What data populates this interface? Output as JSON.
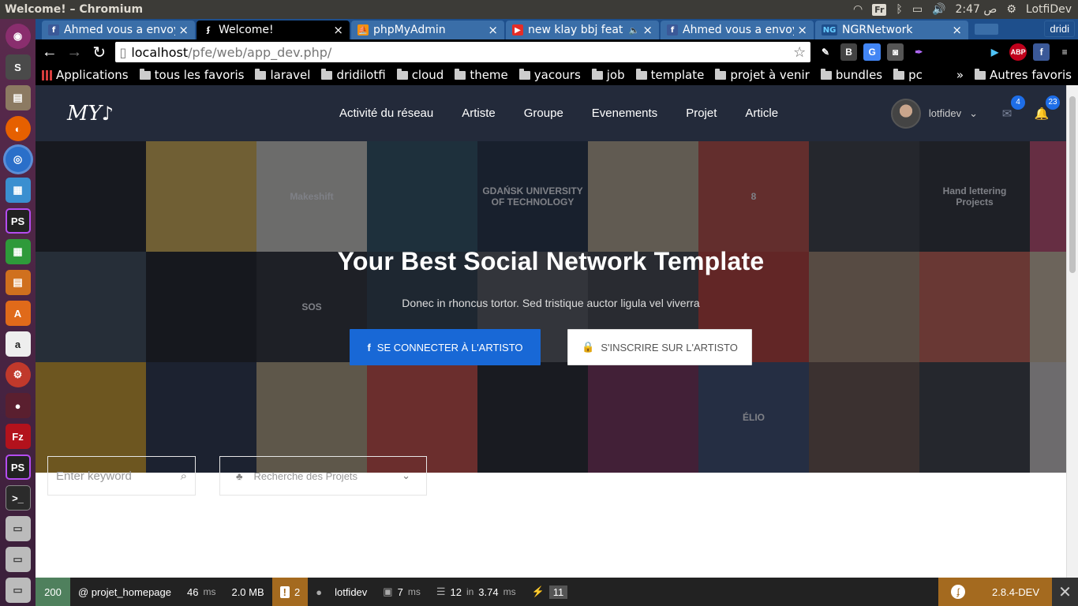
{
  "system": {
    "window_title": "Welcome! – Chromium",
    "keyboard_layout": "Fr",
    "clock": "2:47 ص",
    "user": "LotfiDev"
  },
  "launcher": {
    "items": [
      "ubuntu-icon",
      "sublime-icon",
      "files-icon",
      "firefox-icon",
      "chromium-icon",
      "writer-icon",
      "phpstorm-icon",
      "calc-icon",
      "impress-icon",
      "software-center-icon",
      "amazon-icon",
      "settings-icon",
      "ssh-icon",
      "filezilla-icon",
      "phpstorm-icon",
      "terminal-icon",
      "drive-icon",
      "drive-icon",
      "drive-icon"
    ]
  },
  "browser": {
    "profile": "dridi",
    "tabs": [
      {
        "label": "Ahmed vous a envoy",
        "icon": "facebook-icon",
        "active": false
      },
      {
        "label": "Welcome!",
        "icon": "symfony-icon",
        "active": true
      },
      {
        "label": "phpMyAdmin",
        "icon": "phpmyadmin-icon",
        "active": false
      },
      {
        "label": "new klay bbj feat",
        "icon": "youtube-icon",
        "active": false
      },
      {
        "label": "Ahmed vous a envoy",
        "icon": "facebook-icon",
        "active": false
      },
      {
        "label": "NGRNetwork",
        "icon": "ngr-icon",
        "active": false
      }
    ],
    "url_host": "localhost",
    "url_path": "/pfe/web/app_dev.php/",
    "bookmarks": [
      "Applications",
      "tous les favoris",
      "laravel",
      "dridilotfi",
      "cloud",
      "theme",
      "yacours",
      "job",
      "template",
      "projet à venir",
      "bundles",
      "pc"
    ],
    "bookmarks_more": "»",
    "other_bookmarks": "Autres favoris"
  },
  "site": {
    "logo": "MY",
    "menu": [
      "Activité du réseau",
      "Artiste",
      "Groupe",
      "Evenements",
      "Projet",
      "Article"
    ],
    "username": "lotfidev",
    "messages_count": "4",
    "notifications_count": "23",
    "hero_title": "Your Best Social Network Template",
    "hero_subtitle": "Donec in rhoncus tortor. Sed tristique auctor ligula vel viverra",
    "btn_facebook": "SE CONNECTER À L'ARTISTO",
    "btn_register": "S'INSCRIRE SUR L'ARTISTO",
    "tile_texts": [
      "",
      "",
      "Makeshift",
      "",
      "GDAŃSK UNIVERSITY OF TECHNOLOGY",
      "",
      "8",
      "",
      "Hand lettering Projects",
      "",
      "",
      "",
      "SOS",
      "",
      "",
      "",
      "",
      "",
      "",
      "",
      "",
      "",
      "",
      "",
      "",
      "",
      "ÉLIO",
      "",
      "",
      ""
    ],
    "search_placeholder": "Enter keyword",
    "project_select": "Recherche des Projets"
  },
  "debug_toolbar": {
    "status": "200",
    "route": "@ projet_homepage",
    "time": "46",
    "time_unit": "ms",
    "memory": "2.0 MB",
    "warnings": "2",
    "user": "lotfidev",
    "render_time": "7",
    "render_unit": "ms",
    "queries": "12",
    "queries_in": "in",
    "queries_time": "3.74",
    "queries_unit": "ms",
    "twig": "11",
    "version": "2.8.4-DEV"
  }
}
